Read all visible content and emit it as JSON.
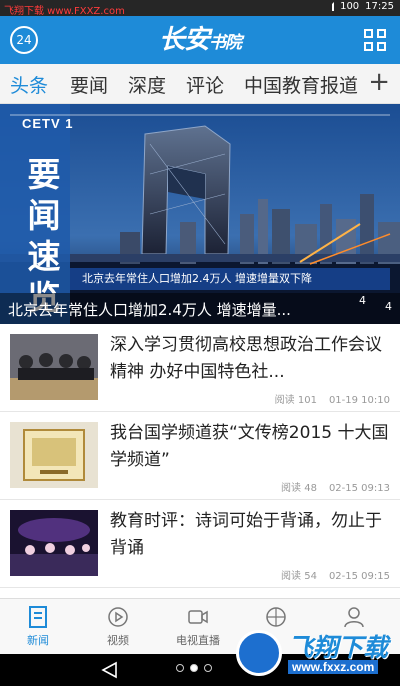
{
  "status_bar": {
    "watermark": "飞翔下载 www.FXXZ.com",
    "battery": "100",
    "time": "17:25"
  },
  "header": {
    "day_badge": "24",
    "logo_main": "长安",
    "logo_small": "书院"
  },
  "tabs": [
    {
      "label": "头条",
      "active": true
    },
    {
      "label": "要闻",
      "active": false
    },
    {
      "label": "深度",
      "active": false
    },
    {
      "label": "评论",
      "active": false
    },
    {
      "label": "中国教育报道",
      "active": false
    }
  ],
  "tabs_more": "+",
  "hero": {
    "channel_logo": "CETV 1",
    "side_label": "要闻速览",
    "ticker": "北京去年常住人口增加2.4万人 增速增量双下降",
    "caption": "北京去年常住人口增加2.4万人 增速增量...",
    "page_indicator": "4",
    "page_indicator_2": "4"
  },
  "news": [
    {
      "title": "深入学习贯彻高校思想政治工作会议精神 办好中国特色社...",
      "read": "阅读 101",
      "date": "01-19 10:10"
    },
    {
      "title": "我台国学频道获“文传榜2015 十大国学频道”",
      "read": "阅读 48",
      "date": "02-15 09:13"
    },
    {
      "title": "教育时评：诗词可始于背诵，勿止于背诵",
      "read": "阅读 54",
      "date": "02-15 09:15"
    }
  ],
  "bottom_nav": [
    {
      "label": "新闻",
      "icon": "news-icon",
      "active": true
    },
    {
      "label": "视频",
      "icon": "play-icon",
      "active": false
    },
    {
      "label": "电视直播",
      "icon": "camera-icon",
      "active": false
    },
    {
      "label": "",
      "icon": "globe-icon",
      "active": false
    },
    {
      "label": "",
      "icon": "user-icon",
      "active": false
    }
  ],
  "watermark_badge": {
    "brand": "飞翔下载",
    "url": "www.fxxz.com"
  },
  "colors": {
    "brand_blue": "#1e8bd8",
    "tab_bg": "#f4f4f4"
  }
}
